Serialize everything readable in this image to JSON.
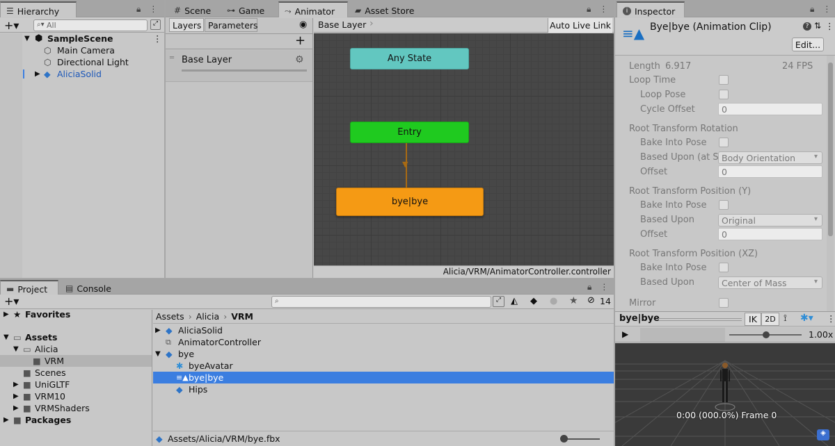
{
  "hierarchy": {
    "tab_label": "Hierarchy",
    "search_placeholder": "All",
    "scene_name": "SampleScene",
    "items": [
      {
        "label": "Main Camera"
      },
      {
        "label": "Directional Light"
      },
      {
        "label": "AliciaSolid"
      }
    ]
  },
  "center_tabs": {
    "scene": "Scene",
    "game": "Game",
    "animator": "Animator",
    "asset_store": "Asset Store"
  },
  "animator": {
    "layers_tab": "Layers",
    "parameters_tab": "Parameters",
    "layer_item": "Base Layer",
    "breadcrumb": "Base Layer",
    "auto_live_link": "Auto Live Link",
    "states": {
      "any_state": "Any State",
      "entry": "Entry",
      "default_state": "bye|bye"
    },
    "controller_path": "Alicia/VRM/AnimatorController.controller"
  },
  "inspector": {
    "tab_label": "Inspector",
    "title": "Bye|bye (Animation Clip)",
    "edit_button": "Edit...",
    "length_label": "Length",
    "length_value": "6.917",
    "fps": "24 FPS",
    "loop_time": "Loop Time",
    "loop_pose": "Loop Pose",
    "cycle_offset": "Cycle Offset",
    "cycle_offset_value": "0",
    "rot_header": "Root Transform Rotation",
    "bake_into_pose": "Bake Into Pose",
    "based_upon_rot": "Based Upon (at Sta",
    "based_upon_rot_value": "Body Orientation",
    "offset_label": "Offset",
    "offset_rot_value": "0",
    "pos_y_header": "Root Transform Position (Y)",
    "based_upon": "Based Upon",
    "based_upon_y_value": "Original",
    "offset_y_value": "0",
    "pos_xz_header": "Root Transform Position (XZ)",
    "based_upon_xz_value": "Center of Mass",
    "mirror": "Mirror"
  },
  "preview": {
    "clip_name": "bye|bye",
    "ik_button": "IK",
    "two_d_button": "2D",
    "speed": "1.00x",
    "time_readout": "0:00 (000.0%) Frame 0"
  },
  "project": {
    "tab_label": "Project",
    "console_tab": "Console",
    "hidden_count": "14",
    "favorites": "Favorites",
    "assets": "Assets",
    "alicia": "Alicia",
    "vrm": "VRM",
    "scenes": "Scenes",
    "unigltf": "UniGLTF",
    "vrm10": "VRM10",
    "vrmshaders": "VRMShaders",
    "packages": "Packages",
    "breadcrumb": [
      "Assets",
      "Alicia",
      "VRM"
    ],
    "files": [
      {
        "label": "AliciaSolid"
      },
      {
        "label": "AnimatorController"
      },
      {
        "label": "bye"
      },
      {
        "label": "byeAvatar"
      },
      {
        "label": "bye|bye"
      },
      {
        "label": "Hips"
      }
    ],
    "selected_path": "Assets/Alicia/VRM/bye.fbx"
  },
  "colors": {
    "any_state": "#62c7c0",
    "entry": "#1fca1f",
    "default_state": "#f59a14",
    "selection": "#3b7ee0",
    "transition": "#a86a13"
  }
}
